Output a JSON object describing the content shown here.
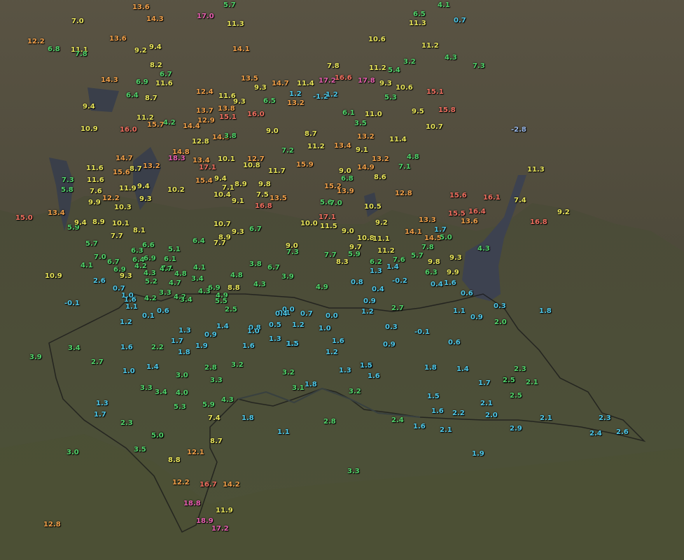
{
  "colors": {
    "cyan": "#4fc8e8",
    "green": "#52d26a",
    "yellow": "#e8e45a",
    "orange": "#f0a04a",
    "red": "#f07060",
    "magenta": "#e860b0",
    "lightblue": "#9ab8e8",
    "white": "#e0e0e0"
  },
  "stations": [
    {
      "v": "13.6",
      "c": "orange"
    },
    {
      "v": "5.7",
      "c": "green"
    },
    {
      "v": "17.0",
      "c": "magenta"
    },
    {
      "v": "14.3",
      "c": "orange"
    },
    {
      "v": "7.0",
      "c": "yellow"
    },
    {
      "v": "11.3",
      "c": "yellow"
    },
    {
      "v": "6.5",
      "c": "green"
    },
    {
      "v": "11.3",
      "c": "yellow"
    },
    {
      "v": "4.1",
      "c": "green"
    },
    {
      "v": "0.7",
      "c": "cyan"
    },
    {
      "v": "12.2",
      "c": "orange"
    },
    {
      "v": "6.8",
      "c": "green"
    },
    {
      "v": "11.1",
      "c": "yellow"
    },
    {
      "v": "7.8",
      "c": "green"
    },
    {
      "v": "13.6",
      "c": "orange"
    },
    {
      "v": "9.2",
      "c": "yellow"
    },
    {
      "v": "9.4",
      "c": "yellow"
    },
    {
      "v": "14.1",
      "c": "orange"
    },
    {
      "v": "10.6",
      "c": "yellow"
    },
    {
      "v": "11.2",
      "c": "yellow"
    },
    {
      "v": "4.3",
      "c": "green"
    },
    {
      "v": "7.3",
      "c": "green"
    },
    {
      "v": "8.2",
      "c": "yellow"
    },
    {
      "v": "6.7",
      "c": "green"
    },
    {
      "v": "11.2",
      "c": "yellow"
    },
    {
      "v": "5.4",
      "c": "green"
    },
    {
      "v": "3.2",
      "c": "green"
    },
    {
      "v": "14.3",
      "c": "orange"
    },
    {
      "v": "6.9",
      "c": "green"
    },
    {
      "v": "11.6",
      "c": "yellow"
    },
    {
      "v": "13.5",
      "c": "orange"
    },
    {
      "v": "9.3",
      "c": "yellow"
    },
    {
      "v": "14.7",
      "c": "orange"
    },
    {
      "v": "7.8",
      "c": "yellow"
    },
    {
      "v": "11.4",
      "c": "yellow"
    },
    {
      "v": "17.2",
      "c": "magenta"
    },
    {
      "v": "16.6",
      "c": "red"
    },
    {
      "v": "17.8",
      "c": "magenta"
    },
    {
      "v": "9.3",
      "c": "yellow"
    },
    {
      "v": "10.6",
      "c": "yellow"
    },
    {
      "v": "15.1",
      "c": "red"
    },
    {
      "v": "6.4",
      "c": "green"
    },
    {
      "v": "8.7",
      "c": "yellow"
    },
    {
      "v": "12.4",
      "c": "orange"
    },
    {
      "v": "11.6",
      "c": "yellow"
    },
    {
      "v": "9.3",
      "c": "yellow"
    },
    {
      "v": "6.5",
      "c": "green"
    },
    {
      "v": "1.2",
      "c": "cyan"
    },
    {
      "v": "13.2",
      "c": "orange"
    },
    {
      "v": "-1.2",
      "c": "cyan"
    },
    {
      "v": "1.2",
      "c": "cyan"
    },
    {
      "v": "5.3",
      "c": "green"
    },
    {
      "v": "9.4",
      "c": "yellow"
    },
    {
      "v": "13.7",
      "c": "orange"
    },
    {
      "v": "13.8",
      "c": "orange"
    },
    {
      "v": "15.1",
      "c": "red"
    },
    {
      "v": "16.0",
      "c": "red"
    },
    {
      "v": "11.2",
      "c": "yellow"
    },
    {
      "v": "12.9",
      "c": "orange"
    },
    {
      "v": "6.1",
      "c": "green"
    },
    {
      "v": "11.0",
      "c": "yellow"
    },
    {
      "v": "9.5",
      "c": "yellow"
    },
    {
      "v": "15.8",
      "c": "red"
    },
    {
      "v": "10.9",
      "c": "yellow"
    },
    {
      "v": "16.0",
      "c": "red"
    },
    {
      "v": "15.7",
      "c": "orange"
    },
    {
      "v": "4.2",
      "c": "green"
    },
    {
      "v": "14.4",
      "c": "orange"
    },
    {
      "v": "3.5",
      "c": "green"
    },
    {
      "v": "10.7",
      "c": "yellow"
    },
    {
      "v": "-2.8",
      "c": "lightblue"
    },
    {
      "v": "9.0",
      "c": "yellow"
    },
    {
      "v": "8.7",
      "c": "yellow"
    },
    {
      "v": "12.8",
      "c": "yellow"
    },
    {
      "v": "14.8",
      "c": "orange"
    },
    {
      "v": "3.8",
      "c": "green"
    },
    {
      "v": "13.2",
      "c": "orange"
    },
    {
      "v": "11.4",
      "c": "yellow"
    },
    {
      "v": "11.2",
      "c": "yellow"
    },
    {
      "v": "13.4",
      "c": "orange"
    },
    {
      "v": "9.1",
      "c": "yellow"
    },
    {
      "v": "14.7",
      "c": "orange"
    },
    {
      "v": "14.8",
      "c": "orange"
    },
    {
      "v": "18.3",
      "c": "magenta"
    },
    {
      "v": "13.4",
      "c": "orange"
    },
    {
      "v": "7.2",
      "c": "green"
    },
    {
      "v": "10.1",
      "c": "yellow"
    },
    {
      "v": "12.7",
      "c": "orange"
    },
    {
      "v": "4.8",
      "c": "green"
    },
    {
      "v": "13.2",
      "c": "orange"
    },
    {
      "v": "11.6",
      "c": "yellow"
    },
    {
      "v": "15.6",
      "c": "orange"
    },
    {
      "v": "13.2",
      "c": "orange"
    },
    {
      "v": "17.1",
      "c": "red"
    },
    {
      "v": "10.8",
      "c": "yellow"
    },
    {
      "v": "15.9",
      "c": "orange"
    },
    {
      "v": "11.7",
      "c": "yellow"
    },
    {
      "v": "9.0",
      "c": "yellow"
    },
    {
      "v": "14.9",
      "c": "orange"
    },
    {
      "v": "7.1",
      "c": "green"
    },
    {
      "v": "11.3",
      "c": "yellow"
    },
    {
      "v": "7.3",
      "c": "green"
    },
    {
      "v": "11.6",
      "c": "yellow"
    },
    {
      "v": "8.7",
      "c": "yellow"
    },
    {
      "v": "15.4",
      "c": "orange"
    },
    {
      "v": "9.4",
      "c": "yellow"
    },
    {
      "v": "6.8",
      "c": "green"
    },
    {
      "v": "8.6",
      "c": "yellow"
    },
    {
      "v": "5.8",
      "c": "green"
    },
    {
      "v": "7.6",
      "c": "yellow"
    },
    {
      "v": "11.9",
      "c": "yellow"
    },
    {
      "v": "9.4",
      "c": "yellow"
    },
    {
      "v": "10.2",
      "c": "yellow"
    },
    {
      "v": "7.1",
      "c": "yellow"
    },
    {
      "v": "8.9",
      "c": "yellow"
    },
    {
      "v": "9.8",
      "c": "yellow"
    },
    {
      "v": "13.5",
      "c": "orange"
    },
    {
      "v": "15.2",
      "c": "orange"
    },
    {
      "v": "13.9",
      "c": "orange"
    },
    {
      "v": "12.8",
      "c": "orange"
    },
    {
      "v": "15.6",
      "c": "red"
    },
    {
      "v": "16.1",
      "c": "red"
    },
    {
      "v": "7.4",
      "c": "yellow"
    },
    {
      "v": "9.2",
      "c": "yellow"
    },
    {
      "v": "15.0",
      "c": "red"
    },
    {
      "v": "13.4",
      "c": "orange"
    },
    {
      "v": "9.9",
      "c": "yellow"
    },
    {
      "v": "12.2",
      "c": "orange"
    },
    {
      "v": "10.3",
      "c": "yellow"
    },
    {
      "v": "9.3",
      "c": "yellow"
    },
    {
      "v": "10.4",
      "c": "yellow"
    },
    {
      "v": "9.1",
      "c": "yellow"
    },
    {
      "v": "7.5",
      "c": "yellow"
    },
    {
      "v": "16.8",
      "c": "red"
    },
    {
      "v": "5.6",
      "c": "green"
    },
    {
      "v": "7.0",
      "c": "green"
    },
    {
      "v": "10.5",
      "c": "yellow"
    },
    {
      "v": "15.5",
      "c": "red"
    },
    {
      "v": "16.4",
      "c": "red"
    },
    {
      "v": "13.6",
      "c": "orange"
    },
    {
      "v": "5.9",
      "c": "green"
    },
    {
      "v": "9.4",
      "c": "yellow"
    },
    {
      "v": "8.9",
      "c": "yellow"
    },
    {
      "v": "10.1",
      "c": "yellow"
    },
    {
      "v": "10.7",
      "c": "yellow"
    },
    {
      "v": "10.0",
      "c": "yellow"
    },
    {
      "v": "11.5",
      "c": "yellow"
    },
    {
      "v": "17.1",
      "c": "red"
    },
    {
      "v": "9.2",
      "c": "yellow"
    },
    {
      "v": "13.3",
      "c": "orange"
    },
    {
      "v": "16.8",
      "c": "red"
    },
    {
      "v": "7.7",
      "c": "yellow"
    },
    {
      "v": "8.1",
      "c": "yellow"
    },
    {
      "v": "8.9",
      "c": "yellow"
    },
    {
      "v": "9.3",
      "c": "yellow"
    },
    {
      "v": "9.0",
      "c": "yellow"
    },
    {
      "v": "10.8",
      "c": "yellow"
    },
    {
      "v": "11.1",
      "c": "yellow"
    },
    {
      "v": "14.1",
      "c": "orange"
    },
    {
      "v": "1.7",
      "c": "cyan"
    },
    {
      "v": "5.7",
      "c": "green"
    },
    {
      "v": "6.6",
      "c": "green"
    },
    {
      "v": "6.4",
      "c": "green"
    },
    {
      "v": "7.7",
      "c": "yellow"
    },
    {
      "v": "9.0",
      "c": "yellow"
    },
    {
      "v": "9.7",
      "c": "yellow"
    },
    {
      "v": "14.5",
      "c": "orange"
    },
    {
      "v": "5.0",
      "c": "green"
    },
    {
      "v": "4.3",
      "c": "green"
    },
    {
      "v": "7.0",
      "c": "green"
    },
    {
      "v": "6.7",
      "c": "green"
    },
    {
      "v": "6.3",
      "c": "green"
    },
    {
      "v": "5.1",
      "c": "green"
    },
    {
      "v": "6.7",
      "c": "green"
    },
    {
      "v": "7.3",
      "c": "green"
    },
    {
      "v": "7.7",
      "c": "green"
    },
    {
      "v": "5.9",
      "c": "green"
    },
    {
      "v": "11.2",
      "c": "yellow"
    },
    {
      "v": "7.8",
      "c": "green"
    },
    {
      "v": "9.3",
      "c": "yellow"
    },
    {
      "v": "6.9",
      "c": "green"
    },
    {
      "v": "6.4",
      "c": "green"
    },
    {
      "v": "6.9",
      "c": "green"
    },
    {
      "v": "6.1",
      "c": "green"
    },
    {
      "v": "8.3",
      "c": "yellow"
    },
    {
      "v": "6.2",
      "c": "green"
    },
    {
      "v": "7.6",
      "c": "green"
    },
    {
      "v": "5.7",
      "c": "green"
    },
    {
      "v": "9.8",
      "c": "yellow"
    },
    {
      "v": "4.1",
      "c": "green"
    },
    {
      "v": "4.2",
      "c": "green"
    },
    {
      "v": "7.1",
      "c": "green"
    },
    {
      "v": "4.8",
      "c": "green"
    },
    {
      "v": "4.1",
      "c": "green"
    },
    {
      "v": "3.8",
      "c": "green"
    },
    {
      "v": "6.7",
      "c": "green"
    },
    {
      "v": "1.3",
      "c": "cyan"
    },
    {
      "v": "1.4",
      "c": "cyan"
    },
    {
      "v": "6.3",
      "c": "green"
    },
    {
      "v": "9.9",
      "c": "yellow"
    },
    {
      "v": "10.9",
      "c": "yellow"
    },
    {
      "v": "9.3",
      "c": "yellow"
    },
    {
      "v": "4.3",
      "c": "green"
    },
    {
      "v": "5.2",
      "c": "green"
    },
    {
      "v": "4.7",
      "c": "green"
    },
    {
      "v": "3.4",
      "c": "green"
    },
    {
      "v": "4.8",
      "c": "green"
    },
    {
      "v": "3.9",
      "c": "green"
    },
    {
      "v": "-0.2",
      "c": "cyan"
    },
    {
      "v": "0.4",
      "c": "cyan"
    },
    {
      "v": "1.6",
      "c": "cyan"
    },
    {
      "v": "2.6",
      "c": "cyan"
    },
    {
      "v": "6.9",
      "c": "green"
    },
    {
      "v": "8.8",
      "c": "yellow"
    },
    {
      "v": "4.3",
      "c": "green"
    },
    {
      "v": "4.9",
      "c": "green"
    },
    {
      "v": "0.8",
      "c": "cyan"
    },
    {
      "v": "0.4",
      "c": "cyan"
    },
    {
      "v": "0.6",
      "c": "cyan"
    },
    {
      "v": "-0.1",
      "c": "cyan"
    },
    {
      "v": "0.7",
      "c": "cyan"
    },
    {
      "v": "1.0",
      "c": "cyan"
    },
    {
      "v": "3.3",
      "c": "green"
    },
    {
      "v": "4.7",
      "c": "green"
    },
    {
      "v": "4.2",
      "c": "green"
    },
    {
      "v": "4.3",
      "c": "green"
    },
    {
      "v": "4.9",
      "c": "green"
    },
    {
      "v": "5.5",
      "c": "green"
    },
    {
      "v": "0.9",
      "c": "cyan"
    },
    {
      "v": "0.0",
      "c": "cyan"
    },
    {
      "v": "0.3",
      "c": "cyan"
    },
    {
      "v": "1.1",
      "c": "cyan"
    },
    {
      "v": "1.6",
      "c": "cyan"
    },
    {
      "v": "4.2",
      "c": "green"
    },
    {
      "v": "3.4",
      "c": "green"
    },
    {
      "v": "2.5",
      "c": "green"
    },
    {
      "v": "0.7",
      "c": "cyan"
    },
    {
      "v": "0.0",
      "c": "cyan"
    },
    {
      "v": "1.2",
      "c": "cyan"
    },
    {
      "v": "2.7",
      "c": "green"
    },
    {
      "v": "1.1",
      "c": "cyan"
    },
    {
      "v": "1.8",
      "c": "cyan"
    },
    {
      "v": "0.1",
      "c": "cyan"
    },
    {
      "v": "0.6",
      "c": "cyan"
    },
    {
      "v": "0.1",
      "c": "cyan"
    },
    {
      "v": "0.4",
      "c": "cyan"
    },
    {
      "v": "0.9",
      "c": "cyan"
    },
    {
      "v": "1.2",
      "c": "cyan"
    },
    {
      "v": "1.2",
      "c": "cyan"
    },
    {
      "v": "1.0",
      "c": "cyan"
    },
    {
      "v": "0.5",
      "c": "cyan"
    },
    {
      "v": "2.0",
      "c": "green"
    },
    {
      "v": "1.3",
      "c": "cyan"
    },
    {
      "v": "1.4",
      "c": "cyan"
    },
    {
      "v": "0.8",
      "c": "cyan"
    },
    {
      "v": "-0.1",
      "c": "cyan"
    },
    {
      "v": "0.3",
      "c": "cyan"
    },
    {
      "v": "0.9",
      "c": "cyan"
    },
    {
      "v": "1.6",
      "c": "cyan"
    },
    {
      "v": "0.6",
      "c": "cyan"
    },
    {
      "v": "1.0",
      "c": "cyan"
    },
    {
      "v": "1.6",
      "c": "cyan"
    },
    {
      "v": "1.7",
      "c": "cyan"
    },
    {
      "v": "1.3",
      "c": "cyan"
    },
    {
      "v": "1.2",
      "c": "cyan"
    },
    {
      "v": "0.9",
      "c": "cyan"
    },
    {
      "v": "2.2",
      "c": "green"
    },
    {
      "v": "1.9",
      "c": "cyan"
    },
    {
      "v": "1.6",
      "c": "cyan"
    },
    {
      "v": "1.2",
      "c": "cyan"
    },
    {
      "v": "1.8",
      "c": "cyan"
    },
    {
      "v": "1.5",
      "c": "cyan"
    },
    {
      "v": "1.8",
      "c": "cyan"
    },
    {
      "v": "2.3",
      "c": "green"
    },
    {
      "v": "2.5",
      "c": "green"
    },
    {
      "v": "2.1",
      "c": "green"
    },
    {
      "v": "3.4",
      "c": "green"
    },
    {
      "v": "3.9",
      "c": "green"
    },
    {
      "v": "2.7",
      "c": "green"
    },
    {
      "v": "1.0",
      "c": "cyan"
    },
    {
      "v": "1.4",
      "c": "cyan"
    },
    {
      "v": "3.0",
      "c": "green"
    },
    {
      "v": "2.8",
      "c": "green"
    },
    {
      "v": "3.2",
      "c": "green"
    },
    {
      "v": "3.2",
      "c": "green"
    },
    {
      "v": "3.3",
      "c": "green"
    },
    {
      "v": "3.1",
      "c": "green"
    },
    {
      "v": "1.8",
      "c": "cyan"
    },
    {
      "v": "1.3",
      "c": "cyan"
    },
    {
      "v": "1.5",
      "c": "cyan"
    },
    {
      "v": "1.6",
      "c": "cyan"
    },
    {
      "v": "1.8",
      "c": "cyan"
    },
    {
      "v": "1.4",
      "c": "cyan"
    },
    {
      "v": "3.3",
      "c": "green"
    },
    {
      "v": "3.2",
      "c": "green"
    },
    {
      "v": "1.7",
      "c": "cyan"
    },
    {
      "v": "2.5",
      "c": "green"
    },
    {
      "v": "3.4",
      "c": "green"
    },
    {
      "v": "4.0",
      "c": "green"
    },
    {
      "v": "5.3",
      "c": "green"
    },
    {
      "v": "5.9",
      "c": "green"
    },
    {
      "v": "4.3",
      "c": "green"
    },
    {
      "v": "1.5",
      "c": "cyan"
    },
    {
      "v": "2.1",
      "c": "cyan"
    },
    {
      "v": "1.3",
      "c": "cyan"
    },
    {
      "v": "1.7",
      "c": "cyan"
    },
    {
      "v": "2.3",
      "c": "green"
    },
    {
      "v": "5.0",
      "c": "green"
    },
    {
      "v": "7.4",
      "c": "yellow"
    },
    {
      "v": "1.8",
      "c": "cyan"
    },
    {
      "v": "1.6",
      "c": "cyan"
    },
    {
      "v": "2.2",
      "c": "cyan"
    },
    {
      "v": "2.0",
      "c": "cyan"
    },
    {
      "v": "2.1",
      "c": "cyan"
    },
    {
      "v": "2.5",
      "c": "green"
    },
    {
      "v": "2.8",
      "c": "green"
    },
    {
      "v": "2.4",
      "c": "green"
    },
    {
      "v": "1.6",
      "c": "cyan"
    },
    {
      "v": "2.1",
      "c": "cyan"
    },
    {
      "v": "2.9",
      "c": "cyan"
    },
    {
      "v": "2.3",
      "c": "cyan"
    },
    {
      "v": "1.1",
      "c": "cyan"
    },
    {
      "v": "5.0",
      "c": "green"
    },
    {
      "v": "8.7",
      "c": "yellow"
    },
    {
      "v": "2.4",
      "c": "cyan"
    },
    {
      "v": "2.6",
      "c": "cyan"
    },
    {
      "v": "3.0",
      "c": "green"
    },
    {
      "v": "3.5",
      "c": "green"
    },
    {
      "v": "12.1",
      "c": "orange"
    },
    {
      "v": "1.9",
      "c": "cyan"
    },
    {
      "v": "8.8",
      "c": "yellow"
    },
    {
      "v": "3.3",
      "c": "green"
    },
    {
      "v": "12.2",
      "c": "orange"
    },
    {
      "v": "16.7",
      "c": "red"
    },
    {
      "v": "14.2",
      "c": "orange"
    },
    {
      "v": "12.8",
      "c": "orange"
    },
    {
      "v": "18.8",
      "c": "magenta"
    },
    {
      "v": "11.9",
      "c": "yellow"
    },
    {
      "v": "18.9",
      "c": "magenta"
    },
    {
      "v": "17.2",
      "c": "magenta"
    }
  ]
}
